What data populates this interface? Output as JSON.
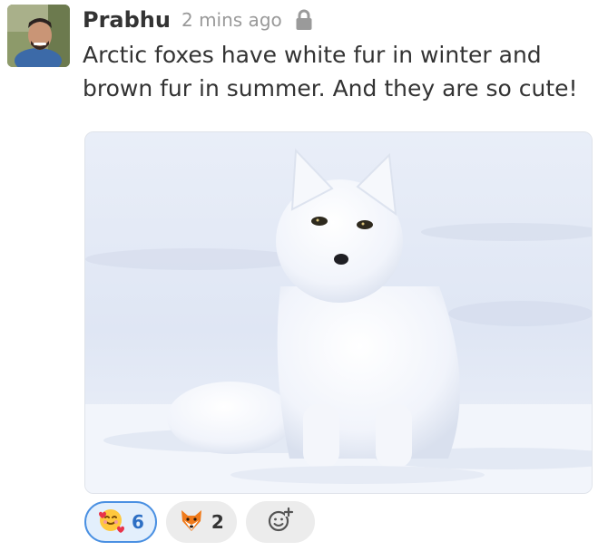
{
  "message": {
    "sender": "Prabhu",
    "timestamp": "2 mins ago",
    "lock_icon": "lock-icon",
    "text": "Arctic foxes have white fur in winter and brown fur in summer. And they are so cute!"
  },
  "reactions": [
    {
      "icon": "smiling-face-with-hearts-icon",
      "count": "6",
      "reacted_by_me": true
    },
    {
      "icon": "fox-face-icon",
      "count": "2",
      "reacted_by_me": false
    }
  ],
  "add_reaction": {
    "icon": "add-emoji-icon"
  },
  "colors": {
    "text": "#333333",
    "muted": "#999999",
    "own_reaction_border": "#4a90e2",
    "own_reaction_bg": "#e3effc",
    "reaction_bg": "#ececec"
  }
}
